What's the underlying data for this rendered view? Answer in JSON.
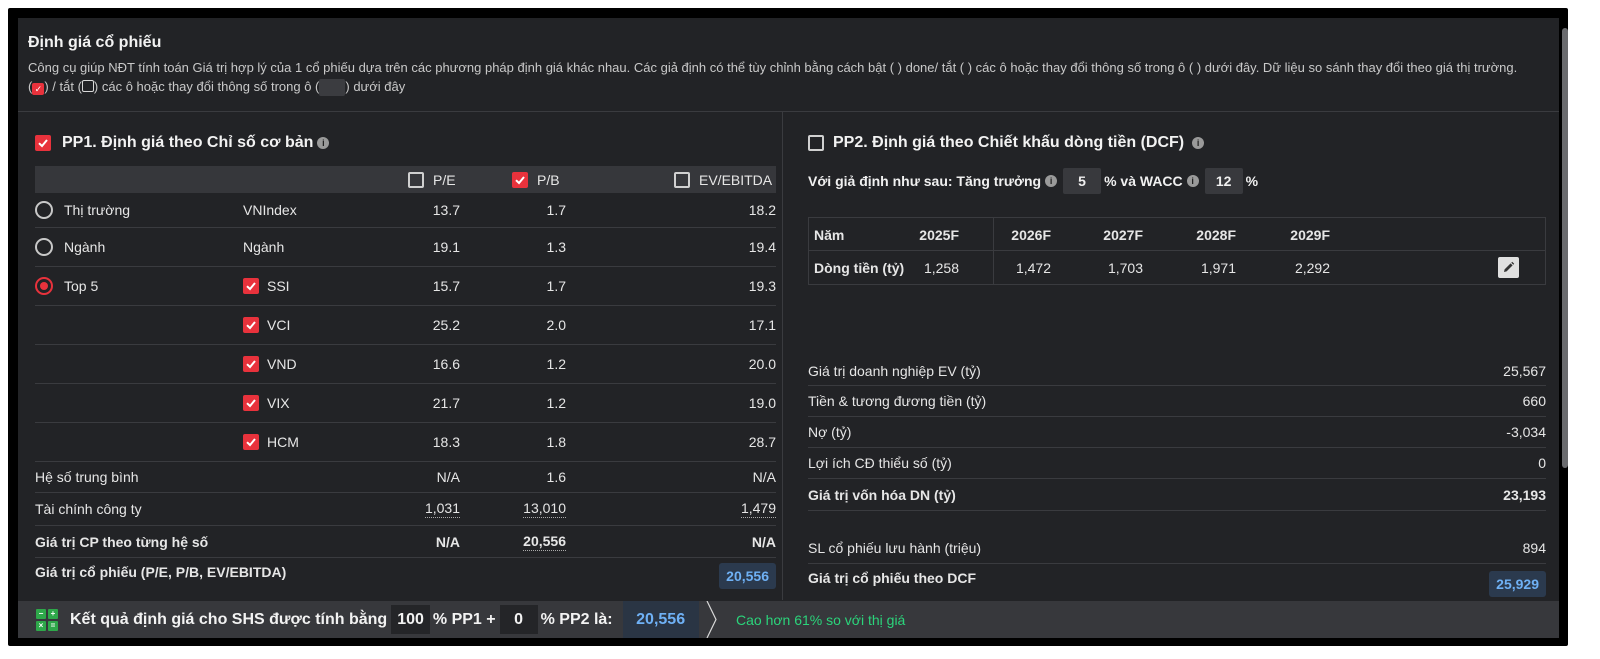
{
  "header": {
    "title": "Định giá cổ phiếu",
    "desc_part1": "Công cụ giúp NĐT tính toán Giá trị hợp lý của 1 cổ phiếu dựa trên các phương pháp định giá khác nhau. Các giả định có thể tùy chỉnh bằng cách bật ( ) done/ tắt ( ) các ô hoặc thay đổi thông số trong ô ( ) dưới đây. Dữ liệu so sánh thay đổi theo giá thị trường. (",
    "desc_part2": ") / tắt (",
    "desc_part3": ") các ô hoặc thay đổi thông số trong ô (",
    "desc_part4": ") dưới đây"
  },
  "pp1": {
    "title": "PP1. Định giá theo Chỉ số cơ bản",
    "columns": {
      "pe": "P/E",
      "pb": "P/B",
      "ev": "EV/EBITDA"
    },
    "rows": [
      {
        "name": "Thị trường",
        "sub": "VNIndex",
        "pe": "13.7",
        "pb": "1.7",
        "ev": "18.2"
      },
      {
        "name": "Ngành",
        "sub": "Ngành",
        "pe": "19.1",
        "pb": "1.3",
        "ev": "19.4"
      },
      {
        "name": "Top 5",
        "sub": "SSI",
        "pe": "15.7",
        "pb": "1.7",
        "ev": "19.3"
      },
      {
        "name": "",
        "sub": "VCI",
        "pe": "25.2",
        "pb": "2.0",
        "ev": "17.1"
      },
      {
        "name": "",
        "sub": "VND",
        "pe": "16.6",
        "pb": "1.2",
        "ev": "20.0"
      },
      {
        "name": "",
        "sub": "VIX",
        "pe": "21.7",
        "pb": "1.2",
        "ev": "19.0"
      },
      {
        "name": "",
        "sub": "HCM",
        "pe": "18.3",
        "pb": "1.8",
        "ev": "28.7"
      }
    ],
    "avg": {
      "label": "Hệ số trung bình",
      "pe": "N/A",
      "pb": "1.6",
      "ev": "N/A"
    },
    "fin": {
      "label": "Tài chính công ty",
      "pe": "1,031",
      "pb": "13,010",
      "ev": "1,479"
    },
    "byratio": {
      "label": "Giá trị CP theo từng hệ số",
      "pe": "N/A",
      "pb": "20,556",
      "ev": "N/A"
    },
    "total": {
      "label": "Giá trị cổ phiếu (P/E, P/B, EV/EBITDA)",
      "value": "20,556"
    }
  },
  "pp2": {
    "title": "PP2. Định giá theo Chiết khấu dòng tiền (DCF)",
    "assume_label": "Với giả định như sau: Tăng trưởng",
    "growth": "5",
    "wacc_label": "% và WACC",
    "wacc": "12",
    "pct": "%",
    "table": {
      "year_label": "Năm",
      "years": [
        "2025F",
        "2026F",
        "2027F",
        "2028F",
        "2029F"
      ],
      "cf_label": "Dòng tiền (tỷ)",
      "cf": [
        "1,258",
        "1,472",
        "1,703",
        "1,971",
        "2,292"
      ]
    },
    "ev_label": "Giá trị doanh nghiệp EV (tỷ)",
    "ev": "25,567",
    "cash_label": "Tiền & tương đương tiền (tỷ)",
    "cash": "660",
    "debt_label": "Nợ (tỷ)",
    "debt": "-3,034",
    "minority_label": "Lợi ích CĐ thiểu số (tỷ)",
    "minority": "0",
    "mcap_label": "Giá trị vốn hóa DN (tỷ)",
    "mcap": "23,193",
    "shares_label": "SL cổ phiếu lưu hành (triệu)",
    "shares": "894",
    "price_label": "Giá trị cổ phiếu theo DCF",
    "price": "25,929"
  },
  "footer": {
    "label1": "Kết quả định giá cho SHS được tính bằng",
    "pp1_weight": "100",
    "label2": "% PP1 +",
    "pp2_weight": "0",
    "label3": "% PP2 là:",
    "result": "20,556",
    "note": "Cao hơn 61% so với thị giá"
  },
  "colors": {
    "accent_red": "#e8323c",
    "value_blue": "#6fb1f5",
    "positive_green": "#2bd47b"
  }
}
